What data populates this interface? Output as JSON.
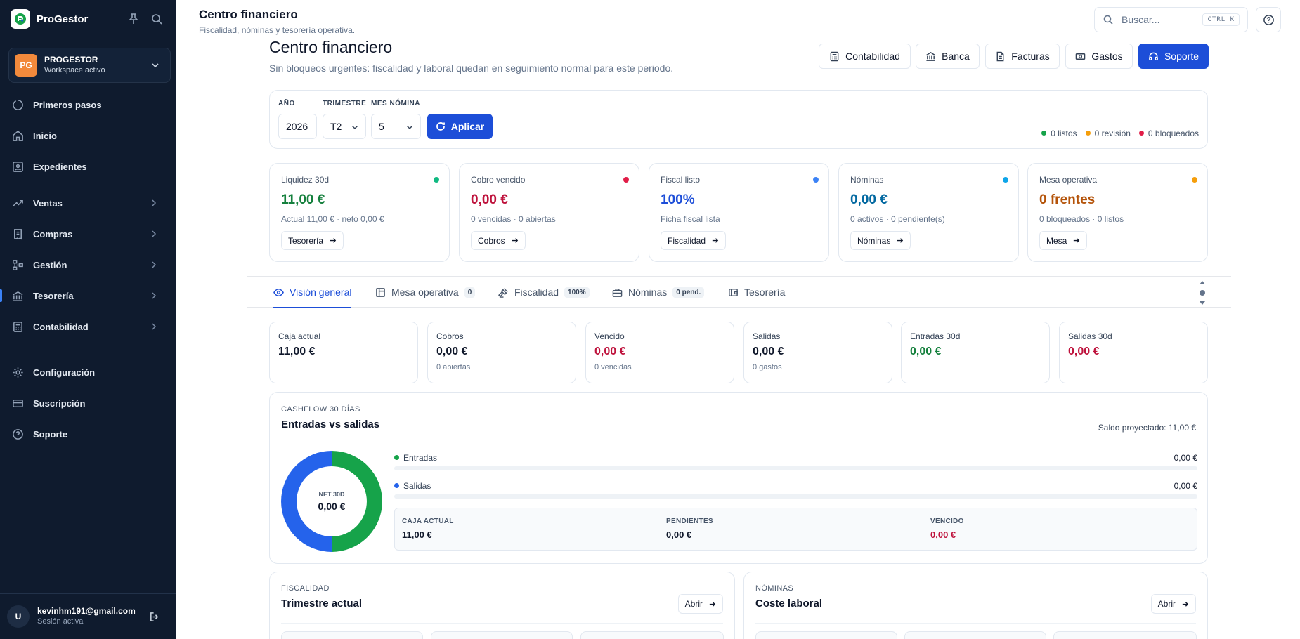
{
  "sidebar": {
    "brand": "ProGestor",
    "workspace": {
      "initials": "PG",
      "name": "PROGESTOR",
      "status": "Workspace activo"
    },
    "items": [
      {
        "label": "Primeros pasos",
        "icon": "progress-circle-icon"
      },
      {
        "label": "Inicio",
        "icon": "home-icon"
      },
      {
        "label": "Expedientes",
        "icon": "id-card-icon"
      },
      {
        "label": "Ventas",
        "icon": "trending-up-icon"
      },
      {
        "label": "Compras",
        "icon": "receipt-icon"
      },
      {
        "label": "Gestión",
        "icon": "workflow-icon"
      },
      {
        "label": "Tesorería",
        "icon": "bank-icon"
      },
      {
        "label": "Contabilidad",
        "icon": "calculator-icon"
      },
      {
        "label": "Configuración",
        "icon": "gear-icon"
      },
      {
        "label": "Suscripción",
        "icon": "credit-card-icon"
      },
      {
        "label": "Soporte",
        "icon": "help-circle-icon"
      }
    ],
    "active_item": "Tesorería",
    "user": {
      "initial": "U",
      "email": "kevinhm191@gmail.com",
      "status": "Sesión activa"
    }
  },
  "header": {
    "title": "Centro financiero",
    "subtitle": "Fiscalidad, nóminas y tesorería operativa.",
    "search_placeholder": "Buscar...",
    "search_shortcut": "CTRL K"
  },
  "page": {
    "title": "Centro financiero",
    "subtitle": "Sin bloqueos urgentes: fiscalidad y laboral quedan en seguimiento normal para este periodo.",
    "quick_actions": [
      "Contabilidad",
      "Banca",
      "Facturas",
      "Gastos",
      "Soporte"
    ]
  },
  "filters": {
    "year_label": "AÑO",
    "year_value": "2026",
    "quarter_label": "TRIMESTRE",
    "quarter_value": "T2",
    "month_label": "MES NÓMINA",
    "month_value": "5",
    "apply_label": "Aplicar",
    "legend": [
      {
        "label": "0 listos",
        "color": "#16a34a"
      },
      {
        "label": "0 revisión",
        "color": "#f59e0b"
      },
      {
        "label": "0 bloqueados",
        "color": "#e11d48"
      }
    ]
  },
  "kpis": [
    {
      "label": "Liquidez 30d",
      "value": "11,00 €",
      "sub": "Actual 11,00 € · neto 0,00 €",
      "button": "Tesorería",
      "dot": "#10b981",
      "value_color": "#15803d"
    },
    {
      "label": "Cobro vencido",
      "value": "0,00 €",
      "sub": "0 vencidas · 0 abiertas",
      "button": "Cobros",
      "dot": "#e11d48",
      "value_color": "#be123c"
    },
    {
      "label": "Fiscal listo",
      "value": "100%",
      "sub": "Ficha fiscal lista",
      "button": "Fiscalidad",
      "dot": "#3b82f6",
      "value_color": "#1d4ed8"
    },
    {
      "label": "Nóminas",
      "value": "0,00 €",
      "sub": "0 activos · 0 pendiente(s)",
      "button": "Nóminas",
      "dot": "#0ea5e9",
      "value_color": "#0369a1"
    },
    {
      "label": "Mesa operativa",
      "value": "0 frentes",
      "sub": "0 bloqueados · 0 listos",
      "button": "Mesa",
      "dot": "#f59e0b",
      "value_color": "#b45309"
    }
  ],
  "tabs": [
    {
      "label": "Visión general",
      "badge": ""
    },
    {
      "label": "Mesa operativa",
      "badge": "0"
    },
    {
      "label": "Fiscalidad",
      "badge": "100%"
    },
    {
      "label": "Nóminas",
      "badge": "0 pend."
    },
    {
      "label": "Tesorería",
      "badge": ""
    }
  ],
  "active_tab": "Visión general",
  "summary": [
    {
      "label": "Caja actual",
      "value": "11,00 €",
      "sub": "",
      "color": "#0f172a"
    },
    {
      "label": "Cobros",
      "value": "0,00 €",
      "sub": "0 abiertas",
      "color": "#0f172a"
    },
    {
      "label": "Vencido",
      "value": "0,00 €",
      "sub": "0 vencidas",
      "color": "#be123c"
    },
    {
      "label": "Salidas",
      "value": "0,00 €",
      "sub": "0 gastos",
      "color": "#0f172a"
    },
    {
      "label": "Entradas 30d",
      "value": "0,00 €",
      "sub": "",
      "color": "#15803d"
    },
    {
      "label": "Salidas 30d",
      "value": "0,00 €",
      "sub": "",
      "color": "#be123c"
    }
  ],
  "cashflow": {
    "kicker": "CASHFLOW 30 DÍAS",
    "title": "Entradas vs salidas",
    "projected": "Saldo proyectado: 11,00 €",
    "donut_label": "NET 30D",
    "donut_value": "0,00 €",
    "rows": [
      {
        "label": "Entradas",
        "value": "0,00 €",
        "color": "#16a34a",
        "fill": 0
      },
      {
        "label": "Salidas",
        "value": "0,00 €",
        "color": "#2563eb",
        "fill": 0
      }
    ],
    "totals": [
      {
        "label": "CAJA ACTUAL",
        "value": "11,00 €",
        "color": "#0f172a"
      },
      {
        "label": "PENDIENTES",
        "value": "0,00 €",
        "color": "#0f172a"
      },
      {
        "label": "VENCIDO",
        "value": "0,00 €",
        "color": "#be123c"
      }
    ]
  },
  "chart_data": {
    "type": "pie",
    "categories": [
      "Entradas",
      "Salidas"
    ],
    "values": [
      50,
      50
    ],
    "colors": [
      "#16a34a",
      "#2563eb"
    ]
  },
  "sections": [
    {
      "kicker": "FISCALIDAD",
      "title": "Trimestre actual",
      "button": "Abrir"
    },
    {
      "kicker": "NÓMINAS",
      "title": "Coste laboral",
      "button": "Abrir"
    }
  ]
}
